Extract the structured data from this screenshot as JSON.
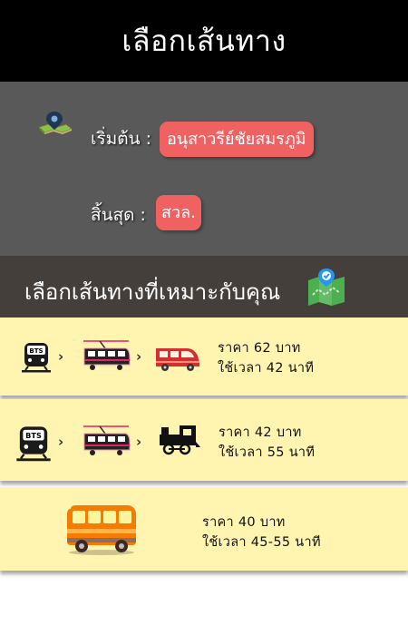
{
  "header": {
    "title": "เลือกเส้นทาง"
  },
  "route": {
    "start_label": "เริ่มต้น :",
    "start_value": "อนุสาวรีย์ชัยสมรภูมิ",
    "end_label": "สิ้นสุด :",
    "end_value": "สวล."
  },
  "section": {
    "title": "เลือกเส้นทางที่เหมาะกับคุณ"
  },
  "options": [
    {
      "icons": [
        "bts-train-icon",
        "tram-icon",
        "red-van-icon"
      ],
      "price": "ราคา 62 บาท",
      "duration": "ใช้เวลา 42 นาที"
    },
    {
      "icons": [
        "bts-train-icon",
        "tram-icon",
        "steam-train-icon"
      ],
      "price": "ราคา 42 บาท",
      "duration": "ใช้เวลา 55 นาที"
    },
    {
      "icons": [
        "orange-bus-icon"
      ],
      "price": "ราคา 40 บาท",
      "duration": "ใช้เวลา 45-55 นาที"
    }
  ],
  "colors": {
    "header_bg": "#000000",
    "route_panel_bg": "#595959",
    "pill_bg": "#f06262",
    "section_bg": "#453f3b",
    "card_bg": "#fff4b0"
  }
}
